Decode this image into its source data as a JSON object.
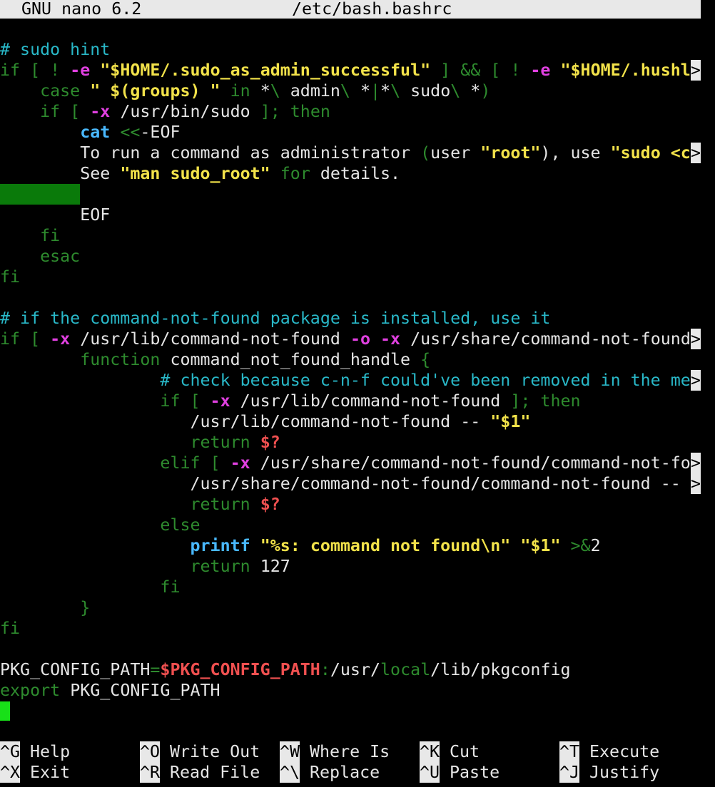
{
  "titlebar": {
    "app": "GNU nano 6.2",
    "file": "/etc/bash.bashrc"
  },
  "lines": [
    [
      {
        "t": "# sudo hint",
        "c": "c-comment"
      }
    ],
    [
      {
        "t": "if [ ! ",
        "c": "c-kw"
      },
      {
        "t": "-e",
        "c": "c-opt"
      },
      {
        "t": " ",
        "c": "c-plain"
      },
      {
        "t": "\"$HOME/.sudo_as_admin_successful\"",
        "c": "c-str"
      },
      {
        "t": " ] && [ ! ",
        "c": "c-kw"
      },
      {
        "t": "-e",
        "c": "c-opt"
      },
      {
        "t": " ",
        "c": "c-plain"
      },
      {
        "t": "\"$HOME/.hushl",
        "c": "c-str"
      }
    ],
    [
      {
        "t": "    case ",
        "c": "c-kw"
      },
      {
        "t": "\" $(groups) \"",
        "c": "c-str"
      },
      {
        "t": " in ",
        "c": "c-kw"
      },
      {
        "t": "*",
        "c": "c-plain"
      },
      {
        "t": "\\",
        "c": "c-kw"
      },
      {
        "t": " admin",
        "c": "c-plain"
      },
      {
        "t": "\\",
        "c": "c-kw"
      },
      {
        "t": " *",
        "c": "c-plain"
      },
      {
        "t": "|",
        "c": "c-kw"
      },
      {
        "t": "*",
        "c": "c-plain"
      },
      {
        "t": "\\",
        "c": "c-kw"
      },
      {
        "t": " sudo",
        "c": "c-plain"
      },
      {
        "t": "\\",
        "c": "c-kw"
      },
      {
        "t": " *",
        "c": "c-plain"
      },
      {
        "t": ")",
        "c": "c-kw"
      }
    ],
    [
      {
        "t": "    if [ ",
        "c": "c-kw"
      },
      {
        "t": "-x",
        "c": "c-opt"
      },
      {
        "t": " /usr/bin/sudo ",
        "c": "c-plain"
      },
      {
        "t": "]; then",
        "c": "c-kw"
      }
    ],
    [
      {
        "t": "        ",
        "c": "c-plain"
      },
      {
        "t": "cat",
        "c": "c-cmd"
      },
      {
        "t": " ",
        "c": "c-plain"
      },
      {
        "t": "<<",
        "c": "c-kw"
      },
      {
        "t": "-EOF",
        "c": "c-plain"
      }
    ],
    [
      {
        "t": "        To run a command as administrator ",
        "c": "c-plain"
      },
      {
        "t": "(",
        "c": "c-kw"
      },
      {
        "t": "user ",
        "c": "c-plain"
      },
      {
        "t": "\"root\"",
        "c": "c-str"
      },
      {
        "t": "), use ",
        "c": "c-plain"
      },
      {
        "t": "\"sudo <c",
        "c": "c-str"
      }
    ],
    [
      {
        "t": "        See ",
        "c": "c-plain"
      },
      {
        "t": "\"man sudo_root\"",
        "c": "c-str"
      },
      {
        "t": " for ",
        "c": "c-kw"
      },
      {
        "t": "details.",
        "c": "c-plain"
      }
    ],
    [],
    [
      {
        "t": "        EOF",
        "c": "c-plain"
      }
    ],
    [
      {
        "t": "    fi",
        "c": "c-kw"
      }
    ],
    [
      {
        "t": "    esac",
        "c": "c-kw"
      }
    ],
    [
      {
        "t": "fi",
        "c": "c-kw"
      }
    ],
    [],
    [
      {
        "t": "# if the command-not-found package is installed, use it",
        "c": "c-comment"
      }
    ],
    [
      {
        "t": "if [ ",
        "c": "c-kw"
      },
      {
        "t": "-x",
        "c": "c-opt"
      },
      {
        "t": " /usr/lib/command-not-found ",
        "c": "c-plain"
      },
      {
        "t": "-o",
        "c": "c-opt"
      },
      {
        "t": " ",
        "c": "c-plain"
      },
      {
        "t": "-x",
        "c": "c-opt"
      },
      {
        "t": " /usr/share/command-not-found",
        "c": "c-plain"
      }
    ],
    [
      {
        "t": "        function ",
        "c": "c-kw"
      },
      {
        "t": "command_not_found_handle ",
        "c": "c-plain"
      },
      {
        "t": "{",
        "c": "c-kw"
      }
    ],
    [
      {
        "t": "                # check because c-n-f could've been removed in the me",
        "c": "c-comment"
      }
    ],
    [
      {
        "t": "                if [ ",
        "c": "c-kw"
      },
      {
        "t": "-x",
        "c": "c-opt"
      },
      {
        "t": " /usr/lib/command-not-found ",
        "c": "c-plain"
      },
      {
        "t": "]; then",
        "c": "c-kw"
      }
    ],
    [
      {
        "t": "                   /usr/lib/command-not-found -- ",
        "c": "c-plain"
      },
      {
        "t": "\"$1\"",
        "c": "c-str"
      }
    ],
    [
      {
        "t": "                   return ",
        "c": "c-kw"
      },
      {
        "t": "$?",
        "c": "c-var"
      }
    ],
    [
      {
        "t": "                elif [ ",
        "c": "c-kw"
      },
      {
        "t": "-x",
        "c": "c-opt"
      },
      {
        "t": " /usr/share/command-not-found/command-not-fo",
        "c": "c-plain"
      }
    ],
    [
      {
        "t": "                   /usr/share/command-not-found/command-not-found -- ",
        "c": "c-plain"
      }
    ],
    [
      {
        "t": "                   return ",
        "c": "c-kw"
      },
      {
        "t": "$?",
        "c": "c-var"
      }
    ],
    [
      {
        "t": "                else",
        "c": "c-kw"
      }
    ],
    [
      {
        "t": "                   ",
        "c": "c-plain"
      },
      {
        "t": "printf",
        "c": "c-cmd"
      },
      {
        "t": " ",
        "c": "c-plain"
      },
      {
        "t": "\"%s: command not found\\n\"",
        "c": "c-str"
      },
      {
        "t": " ",
        "c": "c-plain"
      },
      {
        "t": "\"$1\"",
        "c": "c-str"
      },
      {
        "t": " >&",
        "c": "c-kw"
      },
      {
        "t": "2",
        "c": "c-plain"
      }
    ],
    [
      {
        "t": "                   return ",
        "c": "c-kw"
      },
      {
        "t": "127",
        "c": "c-plain"
      }
    ],
    [
      {
        "t": "                fi",
        "c": "c-kw"
      }
    ],
    [
      {
        "t": "        }",
        "c": "c-kw"
      }
    ],
    [
      {
        "t": "fi",
        "c": "c-kw"
      }
    ],
    [],
    [
      {
        "t": "PKG_CONFIG_PATH",
        "c": "c-plain"
      },
      {
        "t": "=",
        "c": "c-kw"
      },
      {
        "t": "$PKG_CONFIG_PATH",
        "c": "c-var"
      },
      {
        "t": ":",
        "c": "c-kw"
      },
      {
        "t": "/usr/",
        "c": "c-plain"
      },
      {
        "t": "local",
        "c": "c-kw"
      },
      {
        "t": "/lib/pkgconfig",
        "c": "c-plain"
      }
    ],
    [
      {
        "t": "export ",
        "c": "c-kw"
      },
      {
        "t": "PKG_CONFIG_PATH",
        "c": "c-plain"
      }
    ],
    []
  ],
  "truncated_marker": ">",
  "shortcuts": [
    {
      "key": "^G",
      "label": "Help"
    },
    {
      "key": "^O",
      "label": "Write Out"
    },
    {
      "key": "^W",
      "label": "Where Is"
    },
    {
      "key": "^K",
      "label": "Cut"
    },
    {
      "key": "^T",
      "label": "Execute"
    },
    {
      "key": "^X",
      "label": "Exit"
    },
    {
      "key": "^R",
      "label": "Read File"
    },
    {
      "key": "^\\",
      "label": "Replace"
    },
    {
      "key": "^U",
      "label": "Paste"
    },
    {
      "key": "^J",
      "label": "Justify"
    }
  ]
}
